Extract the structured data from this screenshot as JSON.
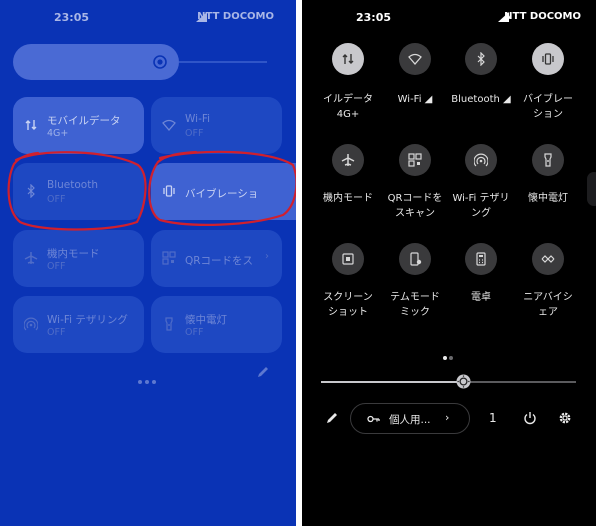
{
  "left_panel": {
    "status_bar": {
      "time": "23:05",
      "carrier": "NTT DOCOMO"
    },
    "brightness_icon": "brightness-auto-icon",
    "tiles": [
      {
        "label": "モバイルデータ",
        "state": "4G+",
        "icon": "mobile-data-icon",
        "on": true
      },
      {
        "label": "Wi-Fi",
        "state": "OFF",
        "icon": "wifi-icon",
        "on": false
      },
      {
        "label": "Bluetooth",
        "state": "OFF",
        "icon": "bluetooth-icon",
        "on": false
      },
      {
        "label": "バイブレーショ",
        "state": "",
        "icon": "vibrate-icon",
        "on": true
      },
      {
        "label": "機内モード",
        "state": "OFF",
        "icon": "airplane-icon",
        "on": false
      },
      {
        "label": "QRコードをス",
        "state": "",
        "icon": "qr-code-icon",
        "on": false,
        "chevron": "›"
      },
      {
        "label": "Wi-Fi テザリング",
        "state": "OFF",
        "icon": "hotspot-icon",
        "on": false
      },
      {
        "label": "懐中電灯",
        "state": "OFF",
        "icon": "flashlight-icon",
        "on": false
      }
    ],
    "highlighted_tiles": [
      "Bluetooth",
      "バイブレーショ"
    ],
    "highlight_color": "#d0202e",
    "edit_icon": "pencil-icon"
  },
  "right_panel": {
    "status_bar": {
      "time": "23:05",
      "carrier": "NTT DOCOMO"
    },
    "tiles": [
      {
        "label": [
          "イルデータ",
          "4G+"
        ],
        "icon": "mobile-data-icon",
        "on": true
      },
      {
        "label": [
          "Wi-Fi ◢"
        ],
        "icon": "wifi-icon",
        "on": false
      },
      {
        "label": [
          "Bluetooth ◢"
        ],
        "icon": "bluetooth-icon",
        "on": false
      },
      {
        "label": [
          "バイブレー",
          "ション"
        ],
        "icon": "vibrate-icon",
        "on": true
      },
      {
        "label": [
          "機内モード"
        ],
        "icon": "airplane-icon",
        "on": false
      },
      {
        "label": [
          "QRコードを",
          "スキャン"
        ],
        "icon": "qr-code-icon",
        "on": false
      },
      {
        "label": [
          "Wi-Fi テザリ",
          "ング"
        ],
        "icon": "hotspot-icon",
        "on": false
      },
      {
        "label": [
          "懐中電灯"
        ],
        "icon": "flashlight-icon",
        "on": false
      },
      {
        "label": [
          "スクリーン",
          "ショット"
        ],
        "icon": "screenshot-icon",
        "on": false
      },
      {
        "label": [
          "テムモード",
          "ミック"
        ],
        "icon": "dark-mode-icon",
        "on": false
      },
      {
        "label": [
          "電卓"
        ],
        "icon": "calculator-icon",
        "on": false
      },
      {
        "label": [
          "ニアバイシ",
          "ェア"
        ],
        "icon": "nearby-share-icon",
        "on": false
      }
    ],
    "page_indicator": {
      "pages": 2,
      "current": 1
    },
    "brightness_level": 0.55,
    "footer": {
      "edit_icon": "pencil-icon",
      "profile_label": "個人用...",
      "profile_chevron": "›",
      "user_count": "1",
      "power_icon": "power-icon",
      "settings_icon": "gear-icon"
    }
  }
}
